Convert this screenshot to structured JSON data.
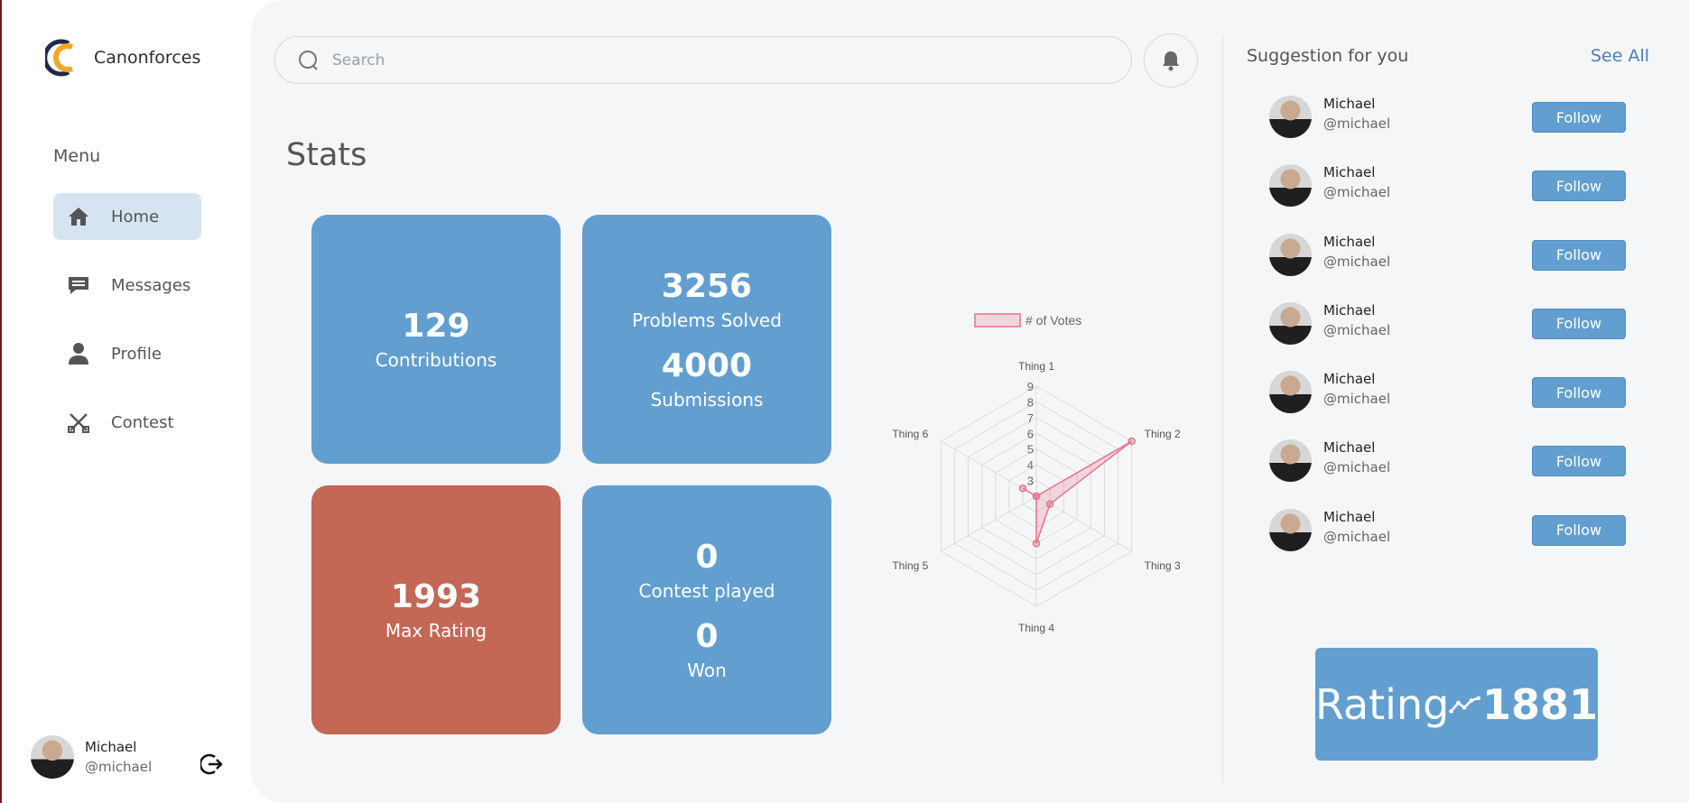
{
  "brand": {
    "name": "Canonforces"
  },
  "sidebar": {
    "menu_label": "Menu",
    "items": [
      {
        "label": "Home",
        "icon": "home-icon",
        "active": true
      },
      {
        "label": "Messages",
        "icon": "messages-icon",
        "active": false
      },
      {
        "label": "Profile",
        "icon": "profile-icon",
        "active": false
      },
      {
        "label": "Contest",
        "icon": "contest-icon",
        "active": false
      }
    ],
    "user": {
      "name": "Michael",
      "handle": "@michael"
    }
  },
  "header": {
    "search_placeholder": "Search"
  },
  "stats": {
    "title": "Stats",
    "contributions": {
      "value": "129",
      "label": "Contributions"
    },
    "problems_solved": {
      "value": "3256",
      "label": "Problems Solved"
    },
    "submissions": {
      "value": "4000",
      "label": "Submissions"
    },
    "max_rating": {
      "value": "1993",
      "label": "Max Rating"
    },
    "contest_played": {
      "value": "0",
      "label": "Contest played"
    },
    "won": {
      "value": "0",
      "label": "Won"
    }
  },
  "chart_data": {
    "type": "radar",
    "categories": [
      "Thing 1",
      "Thing 2",
      "Thing 3",
      "Thing 4",
      "Thing 5",
      "Thing 6"
    ],
    "series": [
      {
        "name": "# of Votes",
        "values": [
          2,
          9,
          3,
          5,
          2,
          3
        ],
        "color": "#e8728a"
      }
    ],
    "rlim": [
      2,
      9
    ],
    "ticks": [
      "3",
      "4",
      "5",
      "6",
      "7",
      "8",
      "9"
    ],
    "legend": "top"
  },
  "suggestions": {
    "title": "Suggestion for you",
    "see_all": "See All",
    "items": [
      {
        "name": "Michael",
        "handle": "@michael",
        "button": "Follow"
      },
      {
        "name": "Michael",
        "handle": "@michael",
        "button": "Follow"
      },
      {
        "name": "Michael",
        "handle": "@michael",
        "button": "Follow"
      },
      {
        "name": "Michael",
        "handle": "@michael",
        "button": "Follow"
      },
      {
        "name": "Michael",
        "handle": "@michael",
        "button": "Follow"
      },
      {
        "name": "Michael",
        "handle": "@michael",
        "button": "Follow"
      },
      {
        "name": "Michael",
        "handle": "@michael",
        "button": "Follow"
      }
    ]
  },
  "rating": {
    "label": "Rating",
    "value": "1881"
  },
  "colors": {
    "accent": "#629fd0",
    "danger": "#c46754",
    "active_nav": "#d6e4f2",
    "logo_orange": "#f5a623",
    "logo_navy": "#1e2a4a"
  }
}
